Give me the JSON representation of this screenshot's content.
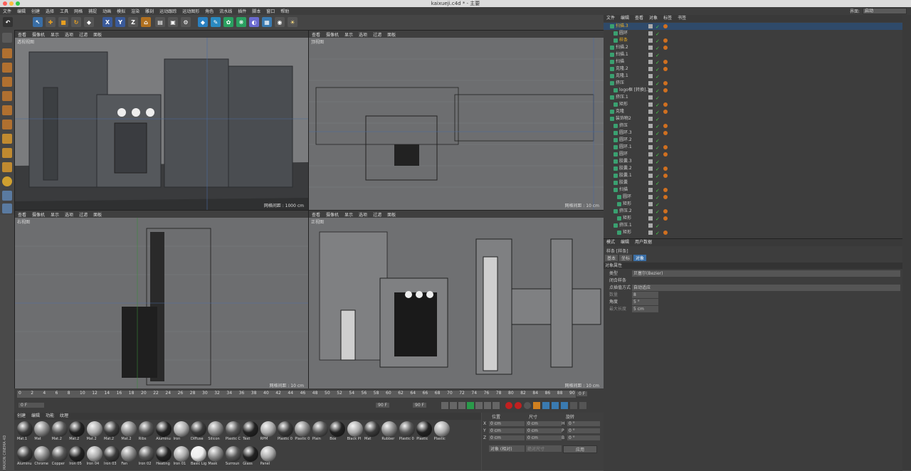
{
  "title": "kaixueji.c4d * - 主要",
  "menu": [
    "文件",
    "编辑",
    "创建",
    "选择",
    "工具",
    "网格",
    "捕捉",
    "动画",
    "模拟",
    "渲染",
    "雕刻",
    "运动跟踪",
    "运动图形",
    "角色",
    "流水线",
    "插件",
    "脚本",
    "窗口",
    "帮助"
  ],
  "layout": {
    "label": "界面:",
    "value": "启动"
  },
  "toolbar_axes": [
    "X",
    "Y",
    "Z"
  ],
  "viewport_menu": [
    "查看",
    "摄像机",
    "显示",
    "选项",
    "过滤",
    "面板"
  ],
  "viewports": [
    {
      "name": "透视视图",
      "grid": "网格间距 : 1000 cm"
    },
    {
      "name": "顶视图",
      "grid": "网格间距 : 10 cm"
    },
    {
      "name": "右视图",
      "grid": "网格间距 : 10 cm"
    },
    {
      "name": "正视图",
      "grid": "网格间距 : 10 cm"
    }
  ],
  "timeline": {
    "ticks": [
      "0",
      "2",
      "4",
      "6",
      "8",
      "10",
      "12",
      "14",
      "16",
      "18",
      "20",
      "22",
      "24",
      "26",
      "28",
      "30",
      "32",
      "34",
      "36",
      "38",
      "40",
      "42",
      "44",
      "46",
      "48",
      "50",
      "52",
      "54",
      "56",
      "58",
      "60",
      "62",
      "64",
      "66",
      "68",
      "70",
      "72",
      "74",
      "76",
      "78",
      "80",
      "82",
      "84",
      "86",
      "88",
      "90"
    ],
    "start": "0 F",
    "end_field": "90 F",
    "current": "0 F",
    "end": "90 F",
    "current_right": "0 F"
  },
  "material_menu": [
    "创建",
    "编辑",
    "功能",
    "纹理"
  ],
  "materials_row1": [
    "Mat.1",
    "Mat",
    "Mat.2",
    "Mat.2",
    "Mat.2",
    "Mat.2",
    "Mat.2",
    "Ribs",
    "Aluminu",
    "Iron",
    "Diffuse",
    "Silicon",
    "Plastic C",
    "Text",
    "RPM",
    "Plastic 0",
    "Plastic 0",
    "Plain",
    "Box",
    "Black Pl",
    "Mat",
    "Rubber",
    "Plastic 0",
    "Plastic",
    "Plastic"
  ],
  "materials_row2": [
    "Aluminu",
    "Chrome",
    "Copper",
    "Iron 05",
    "Iron 04",
    "Iron 03",
    "Fan",
    "Iron 02",
    "Heating",
    "Iron 01",
    "Basic Lig",
    "Mask",
    "Surroun",
    "Glass",
    "Panel"
  ],
  "coords": {
    "headers": [
      "位置",
      "尺寸",
      "旋转"
    ],
    "rows": [
      {
        "axis": "X",
        "pos": "0 cm",
        "size": "0 cm",
        "rl": "H",
        "rot": "0 °"
      },
      {
        "axis": "Y",
        "pos": "0 cm",
        "size": "0 cm",
        "rl": "P",
        "rot": "0 °"
      },
      {
        "axis": "Z",
        "pos": "0 cm",
        "size": "0 cm",
        "rl": "B",
        "rot": "0 °"
      }
    ],
    "mode": "对象 (相对)",
    "size_mode": "绝对尺寸",
    "apply": "应用"
  },
  "obj_menu": [
    "文件",
    "编辑",
    "查看",
    "对象",
    "标签",
    "书签"
  ],
  "objects": [
    {
      "name": "扫描.3",
      "indent": 1,
      "color": "#f0b020",
      "hl": true
    },
    {
      "name": "圆环",
      "indent": 2,
      "color": "#ccc"
    },
    {
      "name": "样条",
      "indent": 2,
      "color": "#f0b020"
    },
    {
      "name": "扫描.2",
      "indent": 1,
      "color": "#ccc"
    },
    {
      "name": "扫描.1",
      "indent": 1,
      "color": "#ccc"
    },
    {
      "name": "扫描",
      "indent": 1,
      "color": "#ccc"
    },
    {
      "name": "克隆.2",
      "indent": 1,
      "color": "#ccc"
    },
    {
      "name": "克隆.1",
      "indent": 1,
      "color": "#ccc"
    },
    {
      "name": "挤压",
      "indent": 1,
      "color": "#ccc"
    },
    {
      "name": "logo框 [转换].1",
      "indent": 2,
      "color": "#ccc"
    },
    {
      "name": "挤压.1",
      "indent": 1,
      "color": "#ccc"
    },
    {
      "name": "矩形",
      "indent": 2,
      "color": "#ccc"
    },
    {
      "name": "克隆",
      "indent": 1,
      "color": "#ccc"
    },
    {
      "name": "装饰物2",
      "indent": 1,
      "color": "#ccc"
    },
    {
      "name": "挤压",
      "indent": 2,
      "color": "#ccc"
    },
    {
      "name": "圆环.3",
      "indent": 2,
      "color": "#ccc"
    },
    {
      "name": "圆环.2",
      "indent": 2,
      "color": "#ccc"
    },
    {
      "name": "圆环.1",
      "indent": 2,
      "color": "#ccc"
    },
    {
      "name": "圆环",
      "indent": 2,
      "color": "#ccc"
    },
    {
      "name": "胶囊.3",
      "indent": 2,
      "color": "#ccc"
    },
    {
      "name": "胶囊.2",
      "indent": 2,
      "color": "#ccc"
    },
    {
      "name": "胶囊.1",
      "indent": 2,
      "color": "#ccc"
    },
    {
      "name": "胶囊",
      "indent": 2,
      "color": "#ccc"
    },
    {
      "name": "扫描",
      "indent": 2,
      "color": "#ccc"
    },
    {
      "name": "圆环",
      "indent": 3,
      "color": "#ccc"
    },
    {
      "name": "矩形",
      "indent": 3,
      "color": "#ccc"
    },
    {
      "name": "挤压.2",
      "indent": 2,
      "color": "#ccc"
    },
    {
      "name": "矩形",
      "indent": 3,
      "color": "#ccc"
    },
    {
      "name": "挤压.1",
      "indent": 2,
      "color": "#ccc"
    },
    {
      "name": "矩形",
      "indent": 3,
      "color": "#ccc"
    }
  ],
  "attr_menu": [
    "模式",
    "编辑",
    "用户数据"
  ],
  "attr_title": "样条 [样条]",
  "attr_tabs": [
    "基本",
    "坐标",
    "对象"
  ],
  "attr_section": "对象属性",
  "attr_rows": [
    {
      "label": "类型",
      "value": "贝塞尔(Bezier)"
    },
    {
      "label": "闭合样条",
      "value": ""
    },
    {
      "label": "点插值方式",
      "value": "自动适应"
    },
    {
      "label": "数量",
      "value": "8"
    },
    {
      "label": "角度",
      "value": "5 °"
    },
    {
      "label": "最大长度",
      "value": "5 cm"
    }
  ],
  "colors": {
    "accent": "#f0b020",
    "bg": "#4a4a4a",
    "viewport": "#6d6d6d"
  },
  "logo": "MAXON CINEMA 4D"
}
